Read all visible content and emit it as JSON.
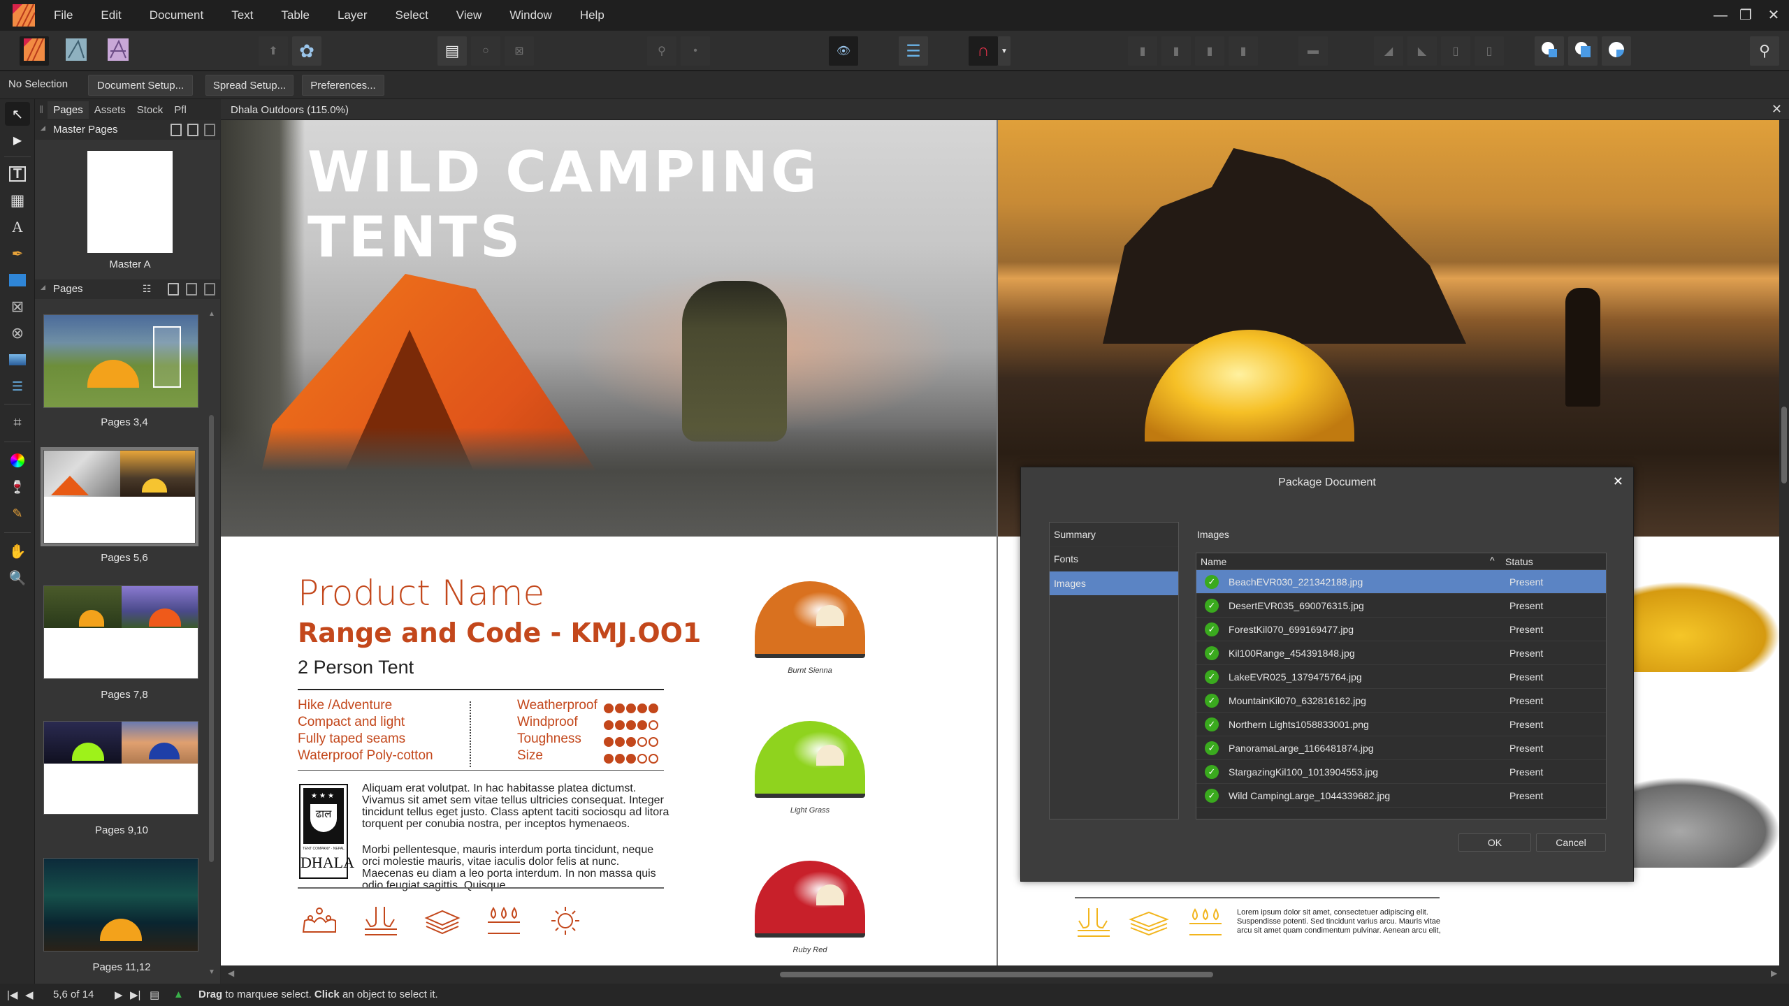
{
  "app": {
    "menus": [
      "File",
      "Edit",
      "Document",
      "Text",
      "Table",
      "Layer",
      "Select",
      "View",
      "Window",
      "Help"
    ],
    "window_controls": {
      "minimize": "—",
      "restore": "❐",
      "close": "✕"
    }
  },
  "context_bar": {
    "selection": "No Selection",
    "buttons": [
      "Document Setup...",
      "Spread Setup...",
      "Preferences..."
    ]
  },
  "panel": {
    "tabs": [
      "Pages",
      "Assets",
      "Stock",
      "Pfl"
    ],
    "active_tab": "Pages",
    "master_section": "Master Pages",
    "master_label": "Master A",
    "pages_section": "Pages",
    "spreads": [
      "Pages 3,4",
      "Pages 5,6",
      "Pages 7,8",
      "Pages 9,10",
      "Pages 11,12"
    ],
    "selected_spread": "Pages 5,6"
  },
  "document": {
    "tab_title": "Dhala Outdoors (115.0%)",
    "headline": "WILD CAMPING TENTS",
    "product_name": "Product Name",
    "range_code": "Range and Code - KMJ.OO1",
    "tent_type": "2 Person Tent",
    "features": [
      "Hike /Adventure",
      "Compact and light",
      "Fully taped seams",
      "Waterproof Poly-cotton"
    ],
    "ratings": [
      {
        "label": "Weatherproof",
        "value": 5,
        "max": 5
      },
      {
        "label": "Windproof",
        "value": 4,
        "max": 5
      },
      {
        "label": "Toughness",
        "value": 3,
        "max": 5
      },
      {
        "label": "Size",
        "value": 3,
        "max": 5
      }
    ],
    "body_p1": "Aliquam erat volutpat. In hac habitasse platea dictumst. Vivamus sit amet sem vitae tellus ultricies consequat. Integer tincidunt tellus eget justo. Class aptent taciti sociosqu ad litora torquent per conubia nostra, per inceptos hymenaeos.",
    "body_p2": "Morbi pellentesque, mauris interdum porta tincidunt, neque orci molestie mauris, vitae iaculis dolor felis at nunc. Maecenas eu diam a leo porta interdum. In non massa quis odio feugiat sagittis. Quisque",
    "logo_text": "DHALA",
    "logo_sub": "TENT COMPANY · NEPAL",
    "logo_devanagari": "ढाल",
    "swatches": [
      {
        "caption": "Burnt Sienna",
        "color": "#d9711f"
      },
      {
        "caption": "Light Grass",
        "color": "#8fd31e"
      },
      {
        "caption": "Ruby Red",
        "color": "#c8202a"
      }
    ],
    "right_body": "Lorem ipsum dolor sit amet, consectetuer adipiscing elit. Suspendisse potenti. Sed tincidunt varius arcu. Mauris vitae arcu sit amet quam condimentum pulvinar. Aenean arcu elit,",
    "accent_color": "#c3471b",
    "accent_color_right": "#f2b51d"
  },
  "dialog": {
    "title": "Package Document",
    "nav": [
      "Summary",
      "Fonts",
      "Images"
    ],
    "nav_selected": "Images",
    "section_label": "Images",
    "col_name": "Name",
    "col_status": "Status",
    "rows": [
      {
        "name": "BeachEVR030_221342188.jpg",
        "status": "Present"
      },
      {
        "name": "DesertEVR035_690076315.jpg",
        "status": "Present"
      },
      {
        "name": "ForestKil070_699169477.jpg",
        "status": "Present"
      },
      {
        "name": "Kil100Range_454391848.jpg",
        "status": "Present"
      },
      {
        "name": "LakeEVR025_1379475764.jpg",
        "status": "Present"
      },
      {
        "name": "MountainKil070_632816162.jpg",
        "status": "Present"
      },
      {
        "name": "Northern Lights1058833001.png",
        "status": "Present"
      },
      {
        "name": "PanoramaLarge_1166481874.jpg",
        "status": "Present"
      },
      {
        "name": "StargazingKil100_1013904553.jpg",
        "status": "Present"
      },
      {
        "name": "Wild CampingLarge_1044339682.jpg",
        "status": "Present"
      }
    ],
    "ok": "OK",
    "cancel": "Cancel",
    "selection_color": "#5b84c4"
  },
  "status_bar": {
    "page_indicator": "5,6 of 14",
    "hint_bold1": "Drag",
    "hint1": " to marquee select. ",
    "hint_bold2": "Click",
    "hint2": " an object to select it."
  }
}
